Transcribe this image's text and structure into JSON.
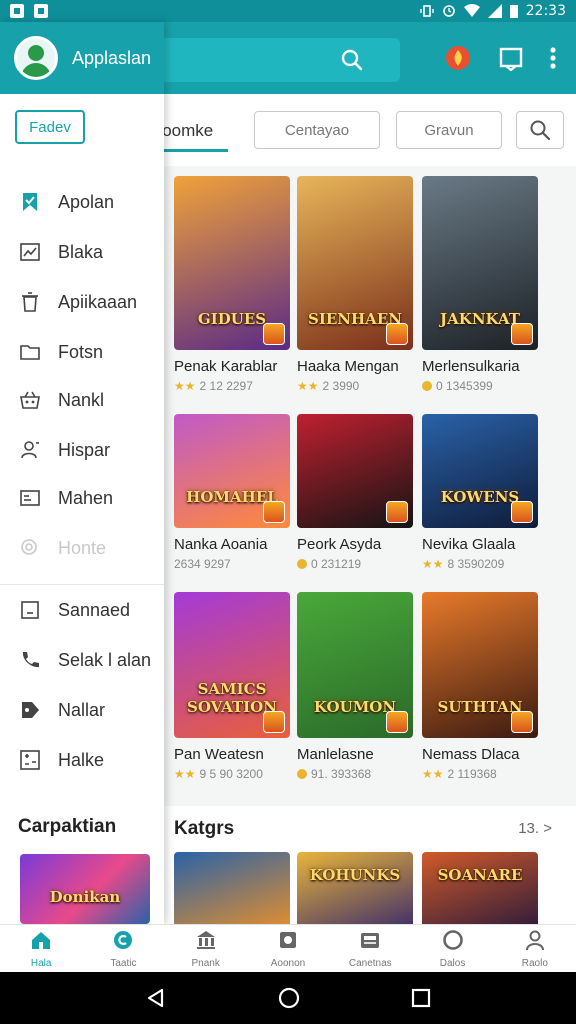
{
  "status_bar": {
    "time": "22:33"
  },
  "app_bar": {
    "title": "Applaslan"
  },
  "filters": {
    "button": "Fadev",
    "active_tab": "Pedesoomke",
    "chip_1": "Centayao",
    "chip_2": "Gravun"
  },
  "drawer": {
    "items": [
      {
        "label": "Apolan",
        "icon": "bookmark-icon"
      },
      {
        "label": "Blaka",
        "icon": "chart-icon"
      },
      {
        "label": "Apiikaaan",
        "icon": "trash-icon"
      },
      {
        "label": "Fotsn",
        "icon": "folder-icon"
      },
      {
        "label": "Nankl",
        "icon": "basket-icon"
      },
      {
        "label": "Hispar",
        "icon": "person-icon"
      },
      {
        "label": "Mahen",
        "icon": "id-card-icon"
      },
      {
        "label": "Honte",
        "icon": "search-icon"
      },
      {
        "label": "Sannaed",
        "icon": "square-icon"
      },
      {
        "label": "Selak l alan",
        "icon": "phone-icon"
      },
      {
        "label": "Nallar",
        "icon": "tag-icon"
      },
      {
        "label": "Halke",
        "icon": "grid-icon"
      }
    ],
    "section_title": "Carpaktian",
    "promo_thumb_title": "Donikan"
  },
  "games": [
    {
      "name": "Penak Karablar",
      "meta": "2 12 2297",
      "meta_icon": "star",
      "thumb_title": "GIDUES",
      "colors": [
        "#f0a23a",
        "#5a2a86"
      ]
    },
    {
      "name": "Haaka Mengan",
      "meta": "2 3990",
      "meta_icon": "star",
      "thumb_title": "SIENHAEN",
      "colors": [
        "#e8b55a",
        "#7a2f1a"
      ]
    },
    {
      "name": "Merlensulkaria",
      "meta": "0 1345399",
      "meta_icon": "coin",
      "thumb_title": "JAKNKAT",
      "colors": [
        "#6a7a86",
        "#1c2126"
      ]
    },
    {
      "name": "Nanka Aoania",
      "meta": "2634 9297",
      "meta_icon": "none",
      "thumb_title": "HOMAHEL",
      "colors": [
        "#c05ac8",
        "#ff8a3a"
      ]
    },
    {
      "name": "Peork Asyda",
      "meta": "0 231219",
      "meta_icon": "coin",
      "thumb_title": "",
      "colors": [
        "#c02030",
        "#141414"
      ]
    },
    {
      "name": "Nevika Glaala",
      "meta": "8 3590209",
      "meta_icon": "star",
      "thumb_title": "KOWENS",
      "colors": [
        "#2a62a8",
        "#0f1c3a"
      ]
    },
    {
      "name": "Pan Weatesn",
      "meta": "9 5 90 3200",
      "meta_icon": "star",
      "thumb_title": "SAMICS SOVATION",
      "colors": [
        "#a43ad8",
        "#e8603a"
      ]
    },
    {
      "name": "Manlelasne",
      "meta": "91. 393368",
      "meta_icon": "coin",
      "thumb_title": "KOUMON",
      "colors": [
        "#4aa83a",
        "#2a6a2a"
      ]
    },
    {
      "name": "Nemass Dlaca",
      "meta": "2 119368",
      "meta_icon": "star",
      "thumb_title": "SUTHTAN",
      "colors": [
        "#e87a2a",
        "#3a1a12"
      ]
    }
  ],
  "category": {
    "title": "Katgrs",
    "more": "13. >",
    "thumbs": [
      {
        "title": "",
        "colors": [
          "#2a62a8",
          "#e8902a"
        ]
      },
      {
        "title": "KOHUNKS",
        "colors": [
          "#e8b53a",
          "#3a2a6a"
        ]
      },
      {
        "title": "SOANARE",
        "colors": [
          "#d05a2a",
          "#2a1a3a"
        ]
      }
    ]
  },
  "bottom_nav": [
    {
      "label": "Hala",
      "icon": "home-icon",
      "active": true
    },
    {
      "label": "Taatic",
      "icon": "cupcake-icon",
      "active": false
    },
    {
      "label": "Pnank",
      "icon": "bank-icon",
      "active": false
    },
    {
      "label": "Aoonon",
      "icon": "camera-icon",
      "active": false
    },
    {
      "label": "Canetnas",
      "icon": "inbox-icon",
      "active": false
    },
    {
      "label": "Dalos",
      "icon": "chat-icon",
      "active": false
    },
    {
      "label": "Raolo",
      "icon": "profile-icon",
      "active": false
    }
  ],
  "colors": {
    "accent": "#17a2ab",
    "status": "#0e8f9a",
    "star": "#e9b52c"
  }
}
